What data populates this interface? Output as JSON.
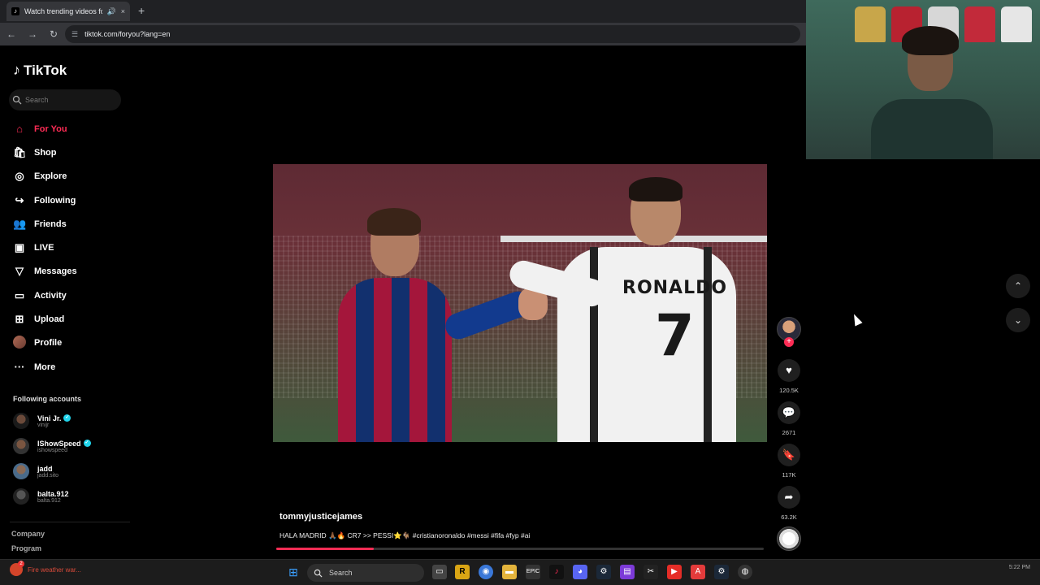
{
  "browser": {
    "tab_title": "Watch trending videos for y",
    "url": "tiktok.com/foryou?lang=en",
    "tab_close": "×",
    "new_tab": "+"
  },
  "tiktok": {
    "logo_text": "TikTok",
    "search_placeholder": "Search",
    "nav": [
      {
        "label": "For You",
        "icon": "home-icon",
        "active": true
      },
      {
        "label": "Shop",
        "icon": "shop-icon"
      },
      {
        "label": "Explore",
        "icon": "compass-icon"
      },
      {
        "label": "Following",
        "icon": "following-icon"
      },
      {
        "label": "Friends",
        "icon": "friends-icon"
      },
      {
        "label": "LIVE",
        "icon": "live-icon"
      },
      {
        "label": "Messages",
        "icon": "messages-icon"
      },
      {
        "label": "Activity",
        "icon": "activity-icon"
      },
      {
        "label": "Upload",
        "icon": "upload-icon"
      },
      {
        "label": "Profile",
        "icon": "avatar"
      },
      {
        "label": "More",
        "icon": "more-icon"
      }
    ],
    "following_header": "Following accounts",
    "following": [
      {
        "name": "Vini Jr.",
        "handle": "vinijr",
        "verified": true
      },
      {
        "name": "IShowSpeed",
        "handle": "ishowspeed",
        "verified": true
      },
      {
        "name": "jadd",
        "handle": "jadd.sito",
        "verified": false
      },
      {
        "name": "balta.912",
        "handle": "balta.912",
        "verified": false
      }
    ],
    "footer_links": [
      "Company",
      "Program"
    ]
  },
  "video": {
    "jersey_name": "RONALDO",
    "jersey_number": "7",
    "author": "tommyjusticejames",
    "caption": "HALA MADRID 🙏🏾🔥 CR7 >> PESSI⭐🐐 #cristianoronaldo #messi #fifa #fyp #ai",
    "progress": 0.2,
    "follow_plus": "+",
    "likes": "120.5K",
    "comments": "2671",
    "saves": "117K",
    "shares": "63.2K"
  },
  "taskbar": {
    "weather_label": "Fire weather war...",
    "weather_sub": "",
    "weather_badge": "2",
    "search_placeholder": "Search",
    "clock": "5:22 PM"
  },
  "colors": {
    "accent": "#fe2c55",
    "background": "#000000",
    "verified": "#20d5ec"
  }
}
